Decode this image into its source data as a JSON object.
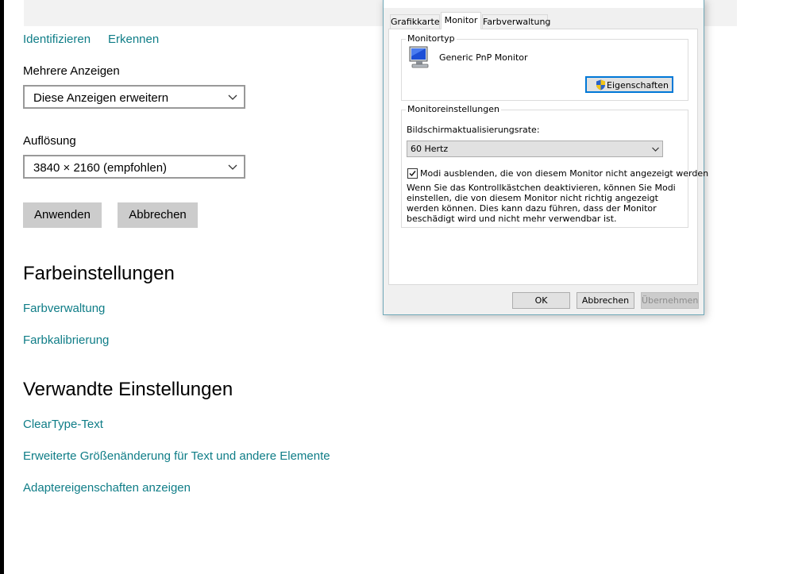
{
  "settings": {
    "identify_link": "Identifizieren",
    "detect_link": "Erkennen",
    "multiple_displays_label": "Mehrere Anzeigen",
    "multiple_displays_value": "Diese Anzeigen erweitern",
    "resolution_label": "Auflösung",
    "resolution_value": "3840 × 2160 (empfohlen)",
    "apply_button": "Anwenden",
    "cancel_button": "Abbrechen",
    "color_heading": "Farbeinstellungen",
    "color_management_link": "Farbverwaltung",
    "color_calibration_link": "Farbkalibrierung",
    "related_heading": "Verwandte Einstellungen",
    "cleartype_link": "ClearType-Text",
    "advanced_sizing_link": "Erweiterte Größenänderung für Text und andere Elemente",
    "adapter_properties_link": "Adaptereigenschaften anzeigen"
  },
  "dialog": {
    "tabs": [
      {
        "label": "Grafikkarte",
        "active": false
      },
      {
        "label": "Monitor",
        "active": true
      },
      {
        "label": "Farbverwaltung",
        "active": false
      }
    ],
    "monitor_type_group": "Monitortyp",
    "monitor_name": "Generic PnP Monitor",
    "properties_button": "Eigenschaften",
    "monitor_settings_group": "Monitoreinstellungen",
    "refresh_rate_label": "Bildschirmaktualisierungsrate:",
    "refresh_rate_value": "60 Hertz",
    "hide_modes_checked": true,
    "hide_modes_label": "Modi ausblenden, die von diesem Monitor nicht angezeigt werden",
    "warning_text": "Wenn Sie das Kontrollkästchen deaktivieren, können Sie Modi einstellen, die von diesem Monitor nicht richtig angezeigt werden können. Dies kann dazu führen, dass der Monitor beschädigt wird und nicht mehr verwendbar ist.",
    "ok_button": "OK",
    "cancel_button": "Abbrechen",
    "apply_button": "Übernehmen"
  },
  "colors": {
    "link": "#0f7d87",
    "button_gray": "#cccccc",
    "dialog_border": "#6fa8b8"
  },
  "icons": {
    "monitor": "monitor-icon",
    "shield": "uac-shield-icon",
    "chevron": "chevron-down-icon",
    "check": "checkmark-icon"
  }
}
